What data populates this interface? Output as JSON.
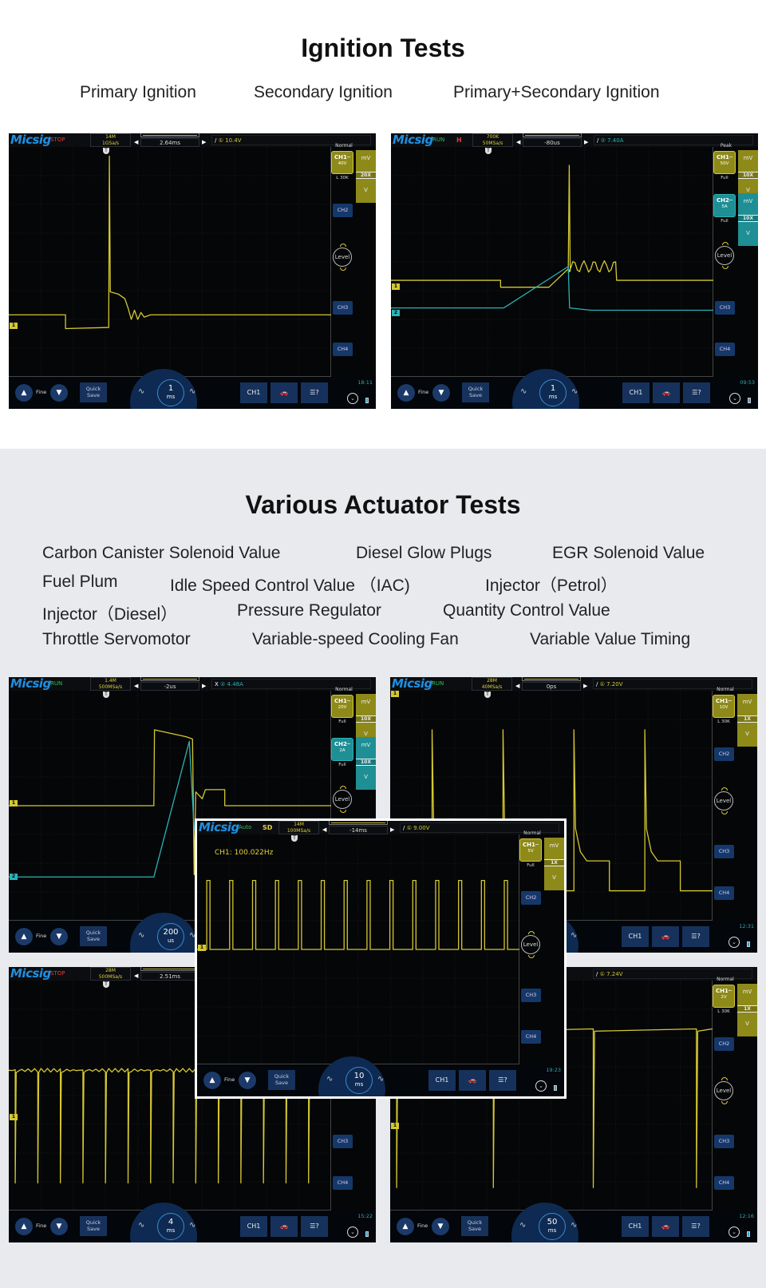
{
  "ignition": {
    "title": "Ignition Tests",
    "subtitles": [
      "Primary Ignition",
      "Secondary Ignition",
      "Primary+Secondary Ignition"
    ]
  },
  "actuator": {
    "title": "Various Actuator Tests",
    "lines": [
      [
        "Carbon Canister Solenoid Value",
        "Diesel Glow Plugs",
        "EGR Solenoid Value"
      ],
      [
        "Fuel Plum",
        "Idle Speed Control Value （IAC)",
        "Injector（Petrol）"
      ],
      [
        "Injector（Diesel）",
        "Pressure Regulator",
        "Quantity Control Value"
      ],
      [
        "Throttle Servomotor",
        "Variable-speed Cooling Fan",
        "Variable Value Timing"
      ]
    ]
  },
  "colors": {
    "ch1": "#d4c832",
    "ch2": "#2ab3b8",
    "probe1": "#8d8a1a",
    "probe2": "#1e8f94",
    "brand": "#1f8fe0",
    "run": "#2fc25a",
    "stop": "#e0403a",
    "bg_section": "#e9eaee"
  },
  "scopes": [
    {
      "logo": "Micsig",
      "status": "STOP",
      "status_color": "#e0403a",
      "extra": "",
      "memory": "14M",
      "sample_rate": "1GSa/s",
      "offset": "2.64ms",
      "trigger_type": "/",
      "trigger_source": "①",
      "trigger_value": "10.4V",
      "trigger_color": "#d4c832",
      "mode": "Normal",
      "active": [
        {
          "label": "CH1",
          "scale": "40V",
          "sub": "L 30K",
          "probe": [
            "mV",
            "20X",
            "V"
          ],
          "color": "ch1"
        }
      ],
      "buttons": [
        "CH2",
        "CH3",
        "CH4"
      ],
      "level": "Level",
      "fine": "Fine",
      "quick_save": [
        "Quick",
        "Save"
      ],
      "timebase": "1",
      "timebase_unit": "ms",
      "time": "18:11",
      "icons": [
        "channel-stack-icon",
        "car-icon",
        "help-menu-icon"
      ]
    },
    {
      "logo": "Micsig",
      "status": "RUN",
      "status_color": "#2fc25a",
      "extra": "H",
      "memory": "700K",
      "sample_rate": "50MSa/s",
      "offset": "-80us",
      "trigger_type": "/",
      "trigger_source": "②",
      "trigger_value": "7.40A",
      "trigger_color": "#2ab3b8",
      "mode": "Peak",
      "active": [
        {
          "label": "CH1",
          "scale": "50V",
          "sub": "Full",
          "probe": [
            "mV",
            "10X",
            "V"
          ],
          "color": "ch1"
        },
        {
          "label": "CH2",
          "scale": "5A",
          "sub": "Full",
          "probe": [
            "mV",
            "10X",
            "V"
          ],
          "color": "ch2"
        }
      ],
      "buttons": [
        "CH3",
        "CH4"
      ],
      "level": "Level",
      "fine": "Fine",
      "quick_save": [
        "Quick",
        "Save"
      ],
      "timebase": "1",
      "timebase_unit": "ms",
      "time": "09:53",
      "icons": [
        "channel-stack-icon",
        "car-icon",
        "help-menu-icon"
      ]
    },
    {
      "logo": "Micsig",
      "status": "RUN",
      "status_color": "#2fc25a",
      "extra": "",
      "memory": "1.4M",
      "sample_rate": "500MSa/s",
      "offset": "-2us",
      "trigger_type": "X",
      "trigger_source": "②",
      "trigger_value": "4.48A",
      "trigger_color": "#2ab3b8",
      "mode": "Normal",
      "active": [
        {
          "label": "CH1",
          "scale": "20V",
          "sub": "Full",
          "probe": [
            "mV",
            "10X",
            "V"
          ],
          "color": "ch1"
        },
        {
          "label": "CH2",
          "scale": "2A",
          "sub": "Full",
          "probe": [
            "mV",
            "10X",
            "V"
          ],
          "color": "ch2"
        }
      ],
      "buttons": [
        "CH3",
        "CH4"
      ],
      "level": "Level",
      "fine": "Fine",
      "quick_save": [
        "Quick",
        "Save"
      ],
      "timebase": "200",
      "timebase_unit": "us",
      "time": "",
      "icons": [
        "channel-stack-icon",
        "car-icon",
        "help-menu-icon"
      ]
    },
    {
      "logo": "Micsig",
      "status": "RUN",
      "status_color": "#2fc25a",
      "extra": "",
      "memory": "28M",
      "sample_rate": "40MSa/s",
      "offset": "0ps",
      "trigger_type": "/",
      "trigger_source": "①",
      "trigger_value": "7.20V",
      "trigger_color": "#d4c832",
      "mode": "Normal",
      "active": [
        {
          "label": "CH1",
          "scale": "10V",
          "sub": "L 30K",
          "probe": [
            "mV",
            "1X",
            "V"
          ],
          "color": "ch1"
        }
      ],
      "buttons": [
        "CH2",
        "CH3",
        "CH4"
      ],
      "level": "Level",
      "fine": "Fine",
      "quick_save": [
        "Quick",
        "Save"
      ],
      "timebase": "",
      "timebase_unit": "",
      "time": "12:31",
      "icons": [
        "channel-stack-icon",
        "car-icon",
        "help-menu-icon"
      ]
    },
    {
      "logo": "Micsig",
      "status": "STOP",
      "status_color": "#e0403a",
      "extra": "",
      "memory": "28M",
      "sample_rate": "500MSa/s",
      "offset": "2.51ms",
      "trigger_type": "",
      "trigger_source": "",
      "trigger_value": "",
      "trigger_color": "#d4c832",
      "mode": "",
      "active": [],
      "buttons": [
        "CH3",
        "CH4"
      ],
      "level": "",
      "fine": "Fine",
      "quick_save": [
        "Quick",
        "Save"
      ],
      "timebase": "4",
      "timebase_unit": "ms",
      "time": "15:22",
      "icons": [
        "channel-stack-icon",
        "car-icon",
        "help-menu-icon"
      ]
    },
    {
      "logo": "",
      "status": "",
      "status_color": "#2fc25a",
      "extra": "",
      "memory": "",
      "sample_rate": "",
      "offset": "",
      "trigger_type": "/",
      "trigger_source": "①",
      "trigger_value": "7.24V",
      "trigger_color": "#d4c832",
      "mode": "Normal",
      "active": [
        {
          "label": "CH1",
          "scale": "2V",
          "sub": "L 30K",
          "probe": [
            "mV",
            "1X",
            "V"
          ],
          "color": "ch1"
        }
      ],
      "buttons": [
        "CH2",
        "CH3",
        "CH4"
      ],
      "level": "Level",
      "fine": "Fine",
      "quick_save": [
        "Quick",
        "Save"
      ],
      "timebase": "50",
      "timebase_unit": "ms",
      "time": "12:16",
      "icons": [
        "channel-stack-icon",
        "car-icon",
        "help-menu-icon"
      ]
    },
    {
      "logo": "Micsig",
      "status": "Auto",
      "status_color": "#2fc25a",
      "extra": "SD",
      "memory": "14M",
      "sample_rate": "100MSa/s",
      "offset": "-14ms",
      "trigger_type": "/",
      "trigger_source": "①",
      "trigger_value": "9.00V",
      "trigger_color": "#d4c832",
      "mode": "Normal",
      "measurement": "CH1: 100.022Hz",
      "active": [
        {
          "label": "CH1",
          "scale": "5V",
          "sub": "Full",
          "probe": [
            "mV",
            "1X",
            "V"
          ],
          "color": "ch1"
        }
      ],
      "buttons": [
        "CH2",
        "CH3",
        "CH4"
      ],
      "level": "Level",
      "fine": "Fine",
      "quick_save": [
        "Quick",
        "Save"
      ],
      "timebase": "10",
      "timebase_unit": "ms",
      "time": "19:23",
      "icons": [
        "channel-stack-icon",
        "car-icon",
        "help-menu-icon"
      ]
    }
  ]
}
